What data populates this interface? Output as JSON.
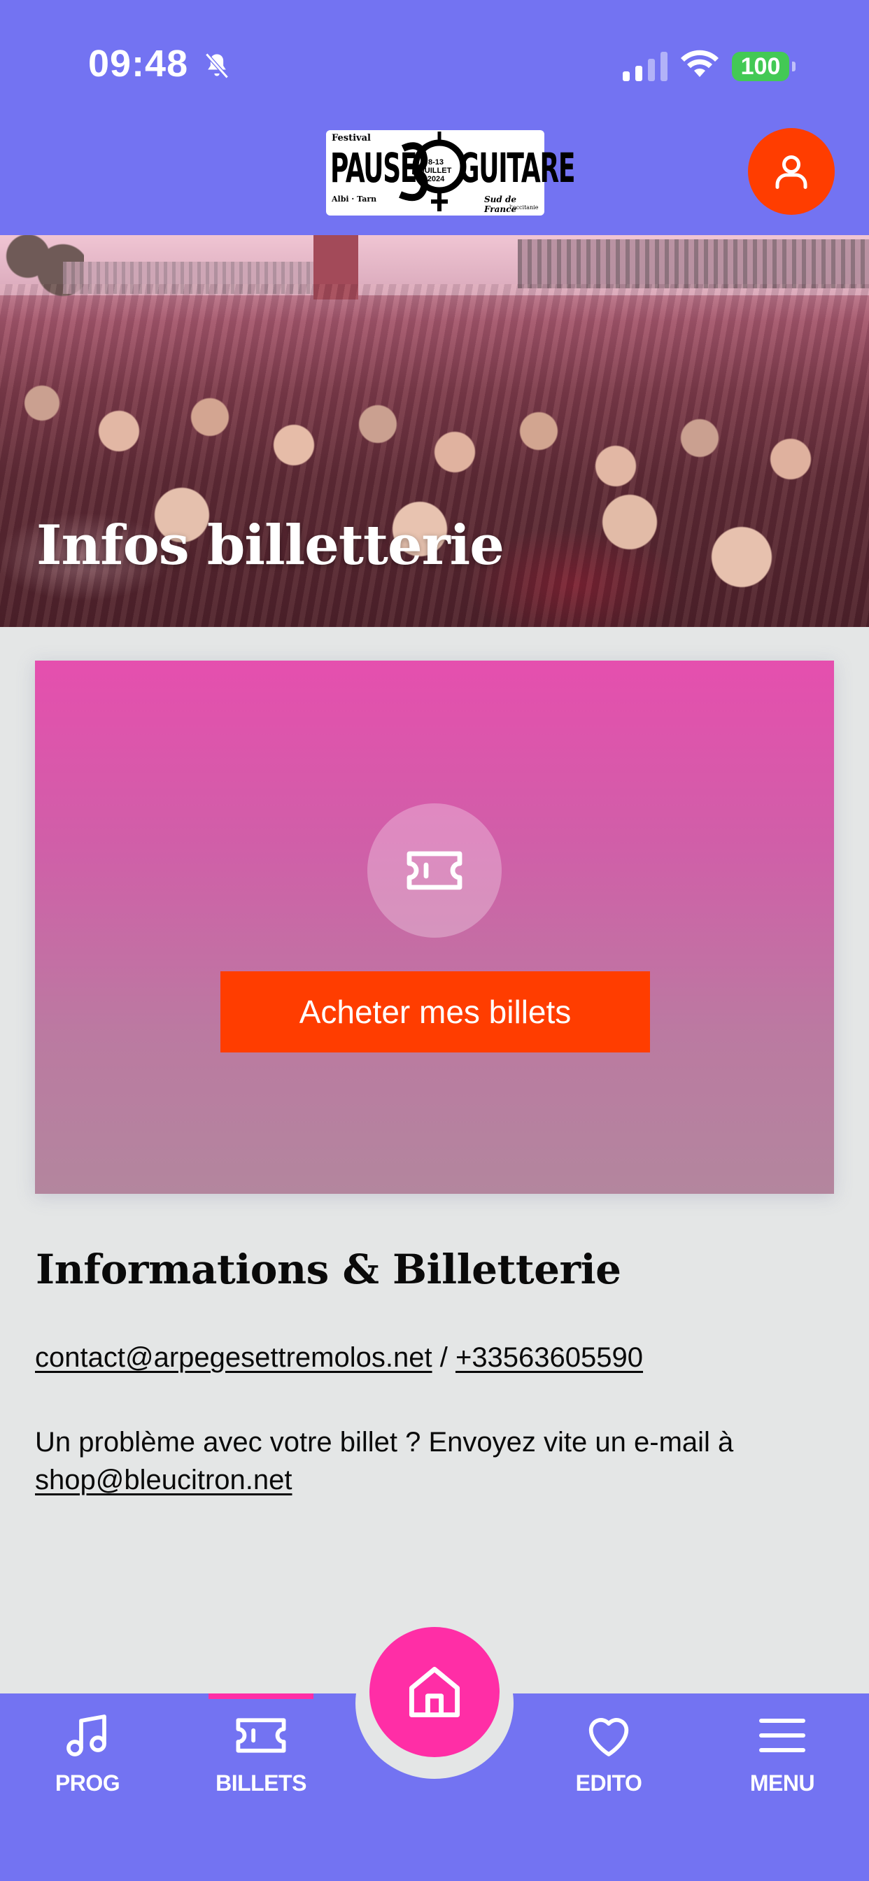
{
  "status_bar": {
    "time": "09:48",
    "battery": "100",
    "battery_color": "#43c955"
  },
  "header": {
    "logo": {
      "small_top": "Festival",
      "word_left": "PAUSE",
      "number": "30",
      "word_right": "GUITARE",
      "dates": "8-13 JUILLET 2024",
      "city": "Albi · Tarn",
      "sponsor": "Sud de France",
      "sponsor_sub": "l'occitanie"
    },
    "profile_icon": "user-icon",
    "accent_color": "#ff3d00"
  },
  "hero": {
    "title": "Infos billetterie"
  },
  "ticket_card": {
    "icon": "ticket-icon",
    "button_label": "Acheter mes billets"
  },
  "info": {
    "title": "Informations & Billetterie",
    "email": "contact@arpegesettremolos.net",
    "separator": "/",
    "phone": "+33563605590",
    "problem_text": "Un problème avec votre billet ? Envoyez vite un e-mail à",
    "problem_email": "shop@bleucitron.net"
  },
  "bottom_nav": {
    "items": [
      {
        "label": "PROG",
        "icon": "music-note-icon"
      },
      {
        "label": "BILLETS",
        "icon": "ticket-icon",
        "active": true
      },
      {
        "label": "EDITO",
        "icon": "heart-icon"
      },
      {
        "label": "MENU",
        "icon": "hamburger-icon"
      }
    ],
    "home_icon": "home-icon",
    "nav_color": "#7373f2",
    "home_color": "#ff2ea6"
  }
}
